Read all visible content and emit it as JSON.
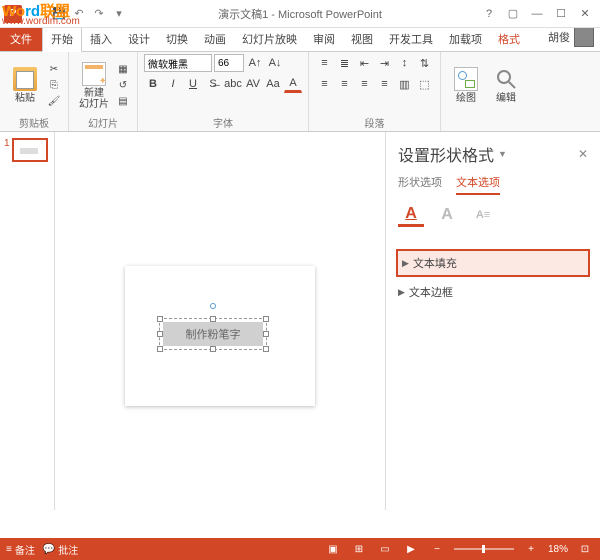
{
  "watermark": {
    "brand_a": "Wo",
    "brand_b": "rd",
    "brand_c": "联盟",
    "url": "www.wordlm.com"
  },
  "titlebar": {
    "title": "演示文稿1 - Microsoft PowerPoint"
  },
  "tabs": {
    "file": "文件",
    "home": "开始",
    "insert": "插入",
    "design": "设计",
    "transitions": "切换",
    "animations": "动画",
    "slideshow": "幻灯片放映",
    "review": "审阅",
    "view": "视图",
    "developer": "开发工具",
    "addins": "加载项",
    "format": "格式",
    "username": "胡俊"
  },
  "ribbon": {
    "clipboard": {
      "label": "剪贴板",
      "paste": "粘贴"
    },
    "slides": {
      "label": "幻灯片",
      "newslide": "新建\n幻灯片"
    },
    "font": {
      "label": "字体",
      "name": "微软雅黑",
      "size": "66"
    },
    "paragraph": {
      "label": "段落"
    },
    "drawing": {
      "label": "",
      "draw": "绘图",
      "edit": "编辑"
    }
  },
  "slide": {
    "num": "1",
    "textbox": "制作粉笔字"
  },
  "taskpane": {
    "title": "设置形状格式",
    "tab_shape": "形状选项",
    "tab_text": "文本选项",
    "sec_fill": "文本填充",
    "sec_outline": "文本边框"
  },
  "status": {
    "notes": "备注",
    "comments": "批注",
    "zoom": "18%"
  }
}
